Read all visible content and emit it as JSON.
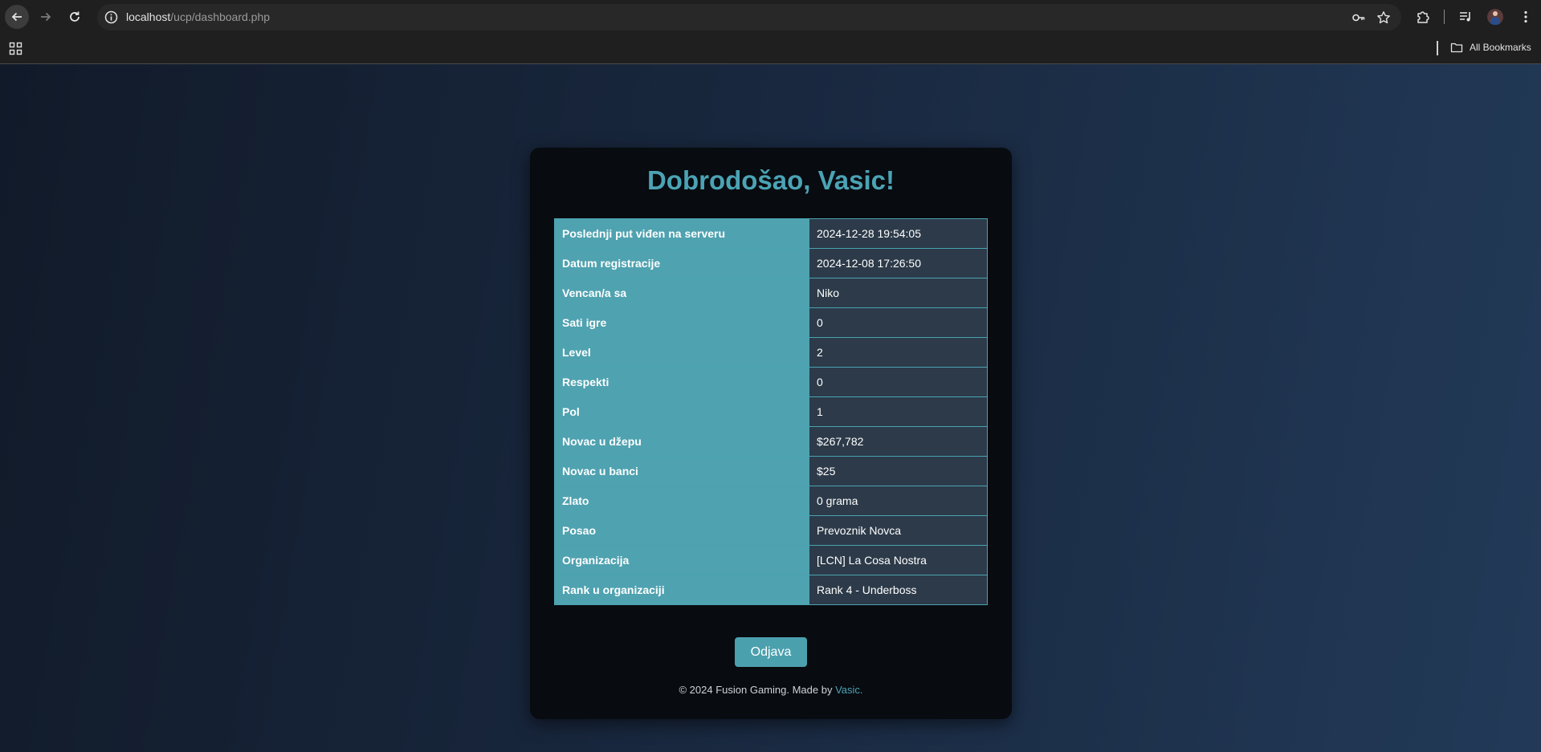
{
  "browser": {
    "url_host": "localhost",
    "url_path": "/ucp/dashboard.php",
    "bookmarks_label": "All Bookmarks"
  },
  "card": {
    "title": "Dobrodošao, Vasic!",
    "rows": [
      {
        "label": "Poslednji put viđen na serveru",
        "value": "2024-12-28 19:54:05"
      },
      {
        "label": "Datum registracije",
        "value": "2024-12-08 17:26:50"
      },
      {
        "label": "Vencan/a sa",
        "value": "Niko"
      },
      {
        "label": "Sati igre",
        "value": "0"
      },
      {
        "label": "Level",
        "value": "2"
      },
      {
        "label": "Respekti",
        "value": "0"
      },
      {
        "label": "Pol",
        "value": "1"
      },
      {
        "label": "Novac u džepu",
        "value": "$267,782"
      },
      {
        "label": "Novac u banci",
        "value": "$25"
      },
      {
        "label": "Zlato",
        "value": "0 grama"
      },
      {
        "label": "Posao",
        "value": "Prevoznik Novca"
      },
      {
        "label": "Organizacija",
        "value": "[LCN] La Cosa Nostra"
      },
      {
        "label": "Rank u organizaciji",
        "value": "Rank 4 - Underboss"
      }
    ],
    "logout_label": "Odjava",
    "footer_text": "© 2024 Fusion Gaming. Made by ",
    "footer_author": "Vasic."
  },
  "colors": {
    "accent": "#4ba3b4",
    "label_cell": "#4fa2b0",
    "value_cell": "#2c3a49",
    "card_bg": "#080b10"
  },
  "icons": [
    "back-arrow-icon",
    "forward-arrow-icon",
    "reload-icon",
    "site-info-icon",
    "password-key-icon",
    "bookmark-star-icon",
    "extensions-icon",
    "media-control-icon",
    "profile-avatar-icon",
    "menu-icon",
    "apps-grid-icon",
    "folder-icon"
  ]
}
